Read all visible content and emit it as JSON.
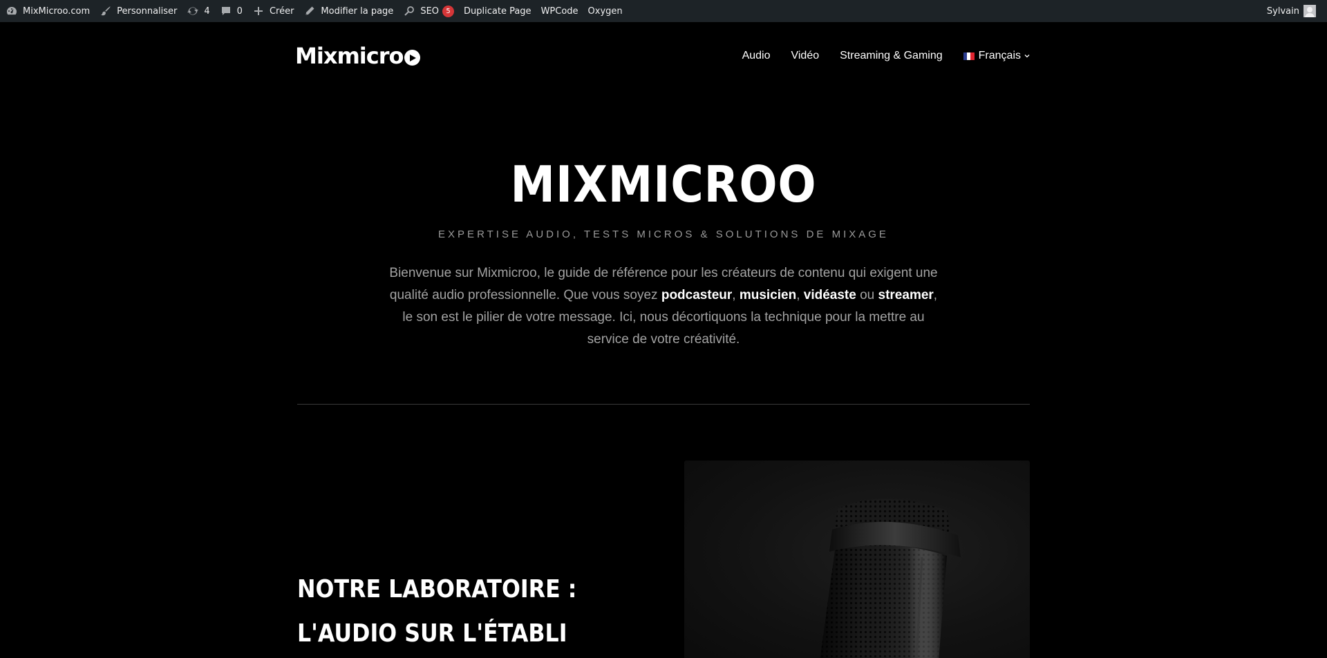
{
  "adminbar": {
    "items": [
      {
        "label": "MixMicroo.com",
        "icon": "dashboard-icon"
      },
      {
        "label": "Personnaliser",
        "icon": "brush-icon"
      },
      {
        "label": "4",
        "icon": "updates-icon"
      },
      {
        "label": "0",
        "icon": "comments-icon"
      },
      {
        "label": "Créer",
        "icon": "plus-icon"
      },
      {
        "label": "Modifier la page",
        "icon": "pencil-icon"
      },
      {
        "label": "SEO",
        "icon": "seo-icon",
        "badge": "5"
      },
      {
        "label": "Duplicate Page"
      },
      {
        "label": "WPCode"
      },
      {
        "label": "Oxygen"
      }
    ],
    "user": {
      "name": "Sylvain",
      "icon": "avatar-icon"
    }
  },
  "header": {
    "logo_text": "Mixmicr",
    "logo_icon": "play-icon",
    "nav": [
      {
        "label": "Audio"
      },
      {
        "label": "Vidéo"
      },
      {
        "label": "Streaming & Gaming"
      },
      {
        "label": "Français",
        "icon": "french-flag-icon",
        "has_dropdown": true
      }
    ]
  },
  "hero": {
    "title": "MIXMICROO",
    "subtitle": "EXPERTISE AUDIO, TESTS MICROS & SOLUTIONS DE MIXAGE",
    "intro_parts": [
      {
        "text": "Bienvenue sur Mixmicroo, le guide de référence pour les créateurs de contenu qui exigent une qualité audio professionnelle. Que vous soyez ",
        "bold": false
      },
      {
        "text": "podcasteur",
        "bold": true
      },
      {
        "text": ", ",
        "bold": false
      },
      {
        "text": "musicien",
        "bold": true
      },
      {
        "text": ", ",
        "bold": false
      },
      {
        "text": "vidéaste",
        "bold": true
      },
      {
        "text": " ou ",
        "bold": false
      },
      {
        "text": "streamer",
        "bold": true
      },
      {
        "text": ", le son est le pilier de votre message. Ici, nous décortiquons la technique pour la mettre au service de votre créativité.",
        "bold": false
      }
    ]
  },
  "lab": {
    "title_line1": "NOTRE LABORATOIRE :",
    "title_line2": "L'AUDIO SUR L'ÉTABLI",
    "image_icon": "microphone-photo"
  },
  "colors": {
    "background": "#000000",
    "adminbar": "#1d2327",
    "badge": "#d63638",
    "muted_text": "#a3a3a3"
  }
}
